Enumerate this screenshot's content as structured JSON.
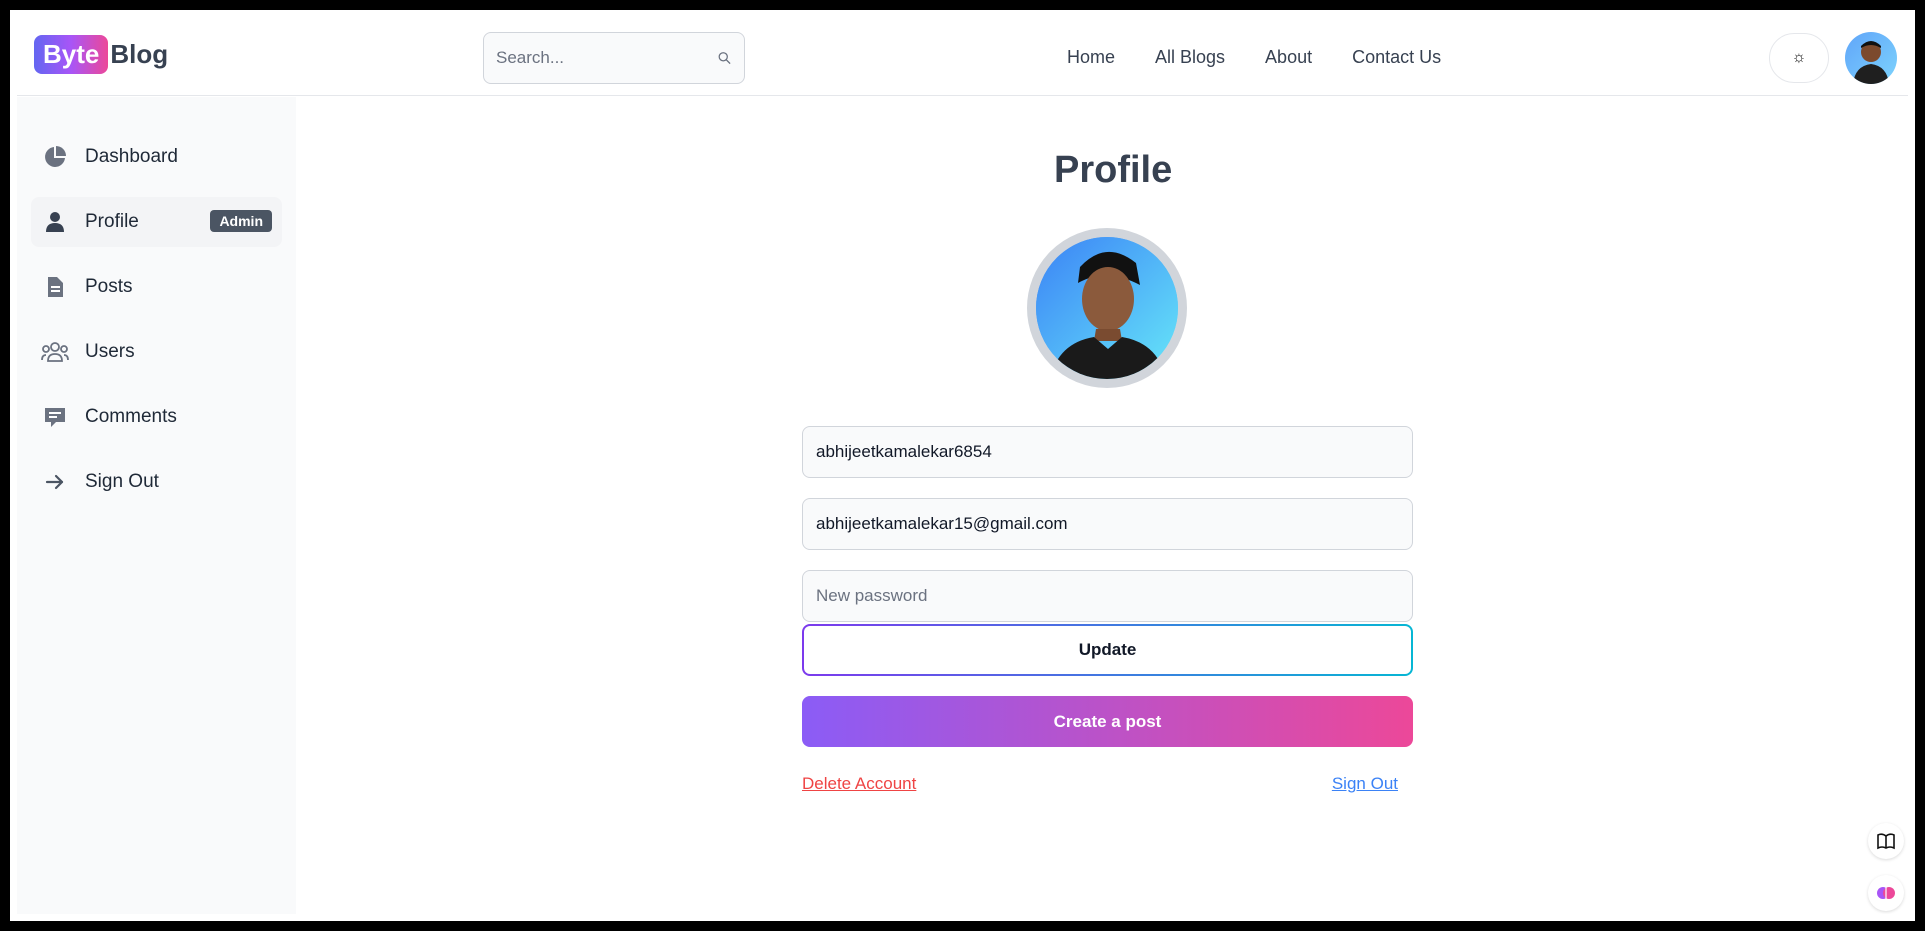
{
  "header": {
    "logo_part1": "Byte",
    "logo_part2": "Blog",
    "search_placeholder": "Search...",
    "nav": [
      "Home",
      "All Blogs",
      "About",
      "Contact Us"
    ],
    "theme_icon": "sun-icon"
  },
  "sidebar": {
    "items": [
      {
        "label": "Dashboard",
        "icon": "pie-chart-icon"
      },
      {
        "label": "Profile",
        "icon": "user-icon",
        "badge": "Admin",
        "active": true
      },
      {
        "label": "Posts",
        "icon": "document-icon"
      },
      {
        "label": "Users",
        "icon": "users-icon"
      },
      {
        "label": "Comments",
        "icon": "comment-icon"
      },
      {
        "label": "Sign Out",
        "icon": "arrow-right-icon"
      }
    ]
  },
  "main": {
    "title": "Profile",
    "username_value": "abhijeetkamalekar6854",
    "email_value": "abhijeetkamalekar15@gmail.com",
    "password_placeholder": "New password",
    "update_label": "Update",
    "create_post_label": "Create a post",
    "delete_label": "Delete Account",
    "signout_label": "Sign Out"
  },
  "colors": {
    "accent_from": "#8b5cf6",
    "accent_to": "#ec4899",
    "delete": "#ef4444",
    "signout": "#3b82f6"
  }
}
